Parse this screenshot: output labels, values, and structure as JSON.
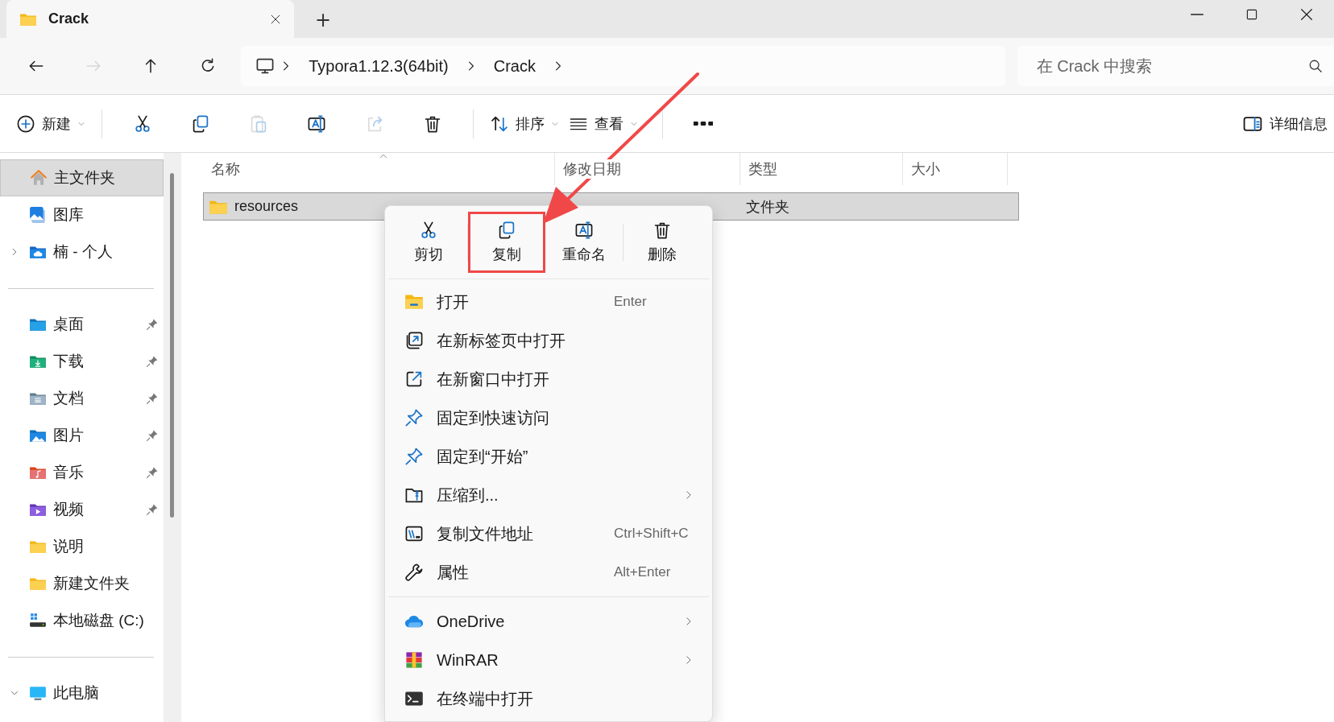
{
  "tabs": [
    {
      "title": "Crack",
      "selected": true
    }
  ],
  "new_tab": "+",
  "navigation": [
    {
      "kind": "back",
      "disabled": false
    },
    {
      "kind": "forward",
      "disabled": true
    },
    {
      "kind": "up",
      "disabled": false
    },
    {
      "kind": "refresh",
      "disabled": false
    }
  ],
  "breadcrumb": [
    "Typora1.12.3(64bit)",
    "Crack"
  ],
  "search": {
    "placeholder": "在 Crack 中搜索"
  },
  "toolbar": [
    {
      "kind": "new",
      "label": "新建",
      "disabled": false
    },
    {
      "kind": "cut",
      "disabled": false
    },
    {
      "kind": "copy",
      "disabled": false
    },
    {
      "kind": "paste",
      "disabled": true
    },
    {
      "kind": "rename",
      "disabled": false
    },
    {
      "kind": "share",
      "disabled": true
    },
    {
      "kind": "delete",
      "disabled": false
    },
    {
      "kind": "sort",
      "label": "排序",
      "disabled": false
    },
    {
      "kind": "view",
      "label": "查看",
      "disabled": false
    },
    {
      "kind": "more",
      "disabled": false
    }
  ],
  "details_button": "详细信息",
  "sidebar": {
    "groups": [
      [
        {
          "kind": "home",
          "label": "主文件夹",
          "selected": true,
          "pinned": false
        },
        {
          "kind": "gallery",
          "label": "图库",
          "selected": false,
          "pinned": false
        },
        {
          "kind": "cloud",
          "label": "楠 - 个人",
          "selected": false,
          "pinned": false,
          "expanded": false
        }
      ],
      [
        {
          "kind": "desktop",
          "label": "桌面",
          "selected": false,
          "pinned": true
        },
        {
          "kind": "downloads",
          "label": "下载",
          "selected": false,
          "pinned": true
        },
        {
          "kind": "documents",
          "label": "文档",
          "selected": false,
          "pinned": true
        },
        {
          "kind": "pictures",
          "label": "图片",
          "selected": false,
          "pinned": true
        },
        {
          "kind": "music",
          "label": "音乐",
          "selected": false,
          "pinned": true
        },
        {
          "kind": "videos",
          "label": "视频",
          "selected": false,
          "pinned": true
        },
        {
          "kind": "folder",
          "label": "说明",
          "selected": false,
          "pinned": false
        },
        {
          "kind": "folder",
          "label": "新建文件夹",
          "selected": false,
          "pinned": false
        },
        {
          "kind": "drive",
          "label": "本地磁盘 (C:)",
          "selected": false,
          "pinned": false
        }
      ],
      [
        {
          "kind": "pc",
          "label": "此电脑",
          "selected": false,
          "pinned": false,
          "expanded": true
        }
      ]
    ]
  },
  "columns": [
    {
      "label": "名称",
      "sorted": true
    },
    {
      "label": "修改日期",
      "sorted": false
    },
    {
      "label": "类型",
      "sorted": false
    },
    {
      "label": "大小",
      "sorted": false
    }
  ],
  "rows": [
    {
      "name": "resources",
      "type": "文件夹",
      "selected": true
    }
  ],
  "context_menu": {
    "actions": [
      {
        "kind": "cut",
        "label": "剪切",
        "highlighted": false
      },
      {
        "kind": "copy",
        "label": "复制",
        "highlighted": true
      },
      {
        "kind": "rename",
        "label": "重命名",
        "highlighted": false
      },
      {
        "kind": "delete",
        "label": "删除",
        "highlighted": false
      }
    ],
    "groups": [
      [
        {
          "kind": "open",
          "label": "打开",
          "shortcut": "Enter",
          "submenu": false
        },
        {
          "kind": "newtab",
          "label": "在新标签页中打开",
          "submenu": false
        },
        {
          "kind": "newwindow",
          "label": "在新窗口中打开",
          "submenu": false
        },
        {
          "kind": "pin",
          "label": "固定到快速访问",
          "submenu": false
        },
        {
          "kind": "pin",
          "label": "固定到“开始”",
          "submenu": false
        },
        {
          "kind": "zip",
          "label": "压缩到...",
          "submenu": true
        },
        {
          "kind": "path",
          "label": "复制文件地址",
          "shortcut": "Ctrl+Shift+C",
          "submenu": false
        },
        {
          "kind": "properties",
          "label": "属性",
          "shortcut": "Alt+Enter",
          "submenu": false
        }
      ],
      [
        {
          "kind": "onedrive",
          "label": "OneDrive",
          "submenu": true
        },
        {
          "kind": "winrar",
          "label": "WinRAR",
          "submenu": true
        },
        {
          "kind": "terminal",
          "label": "在终端中打开",
          "submenu": false
        }
      ]
    ]
  }
}
